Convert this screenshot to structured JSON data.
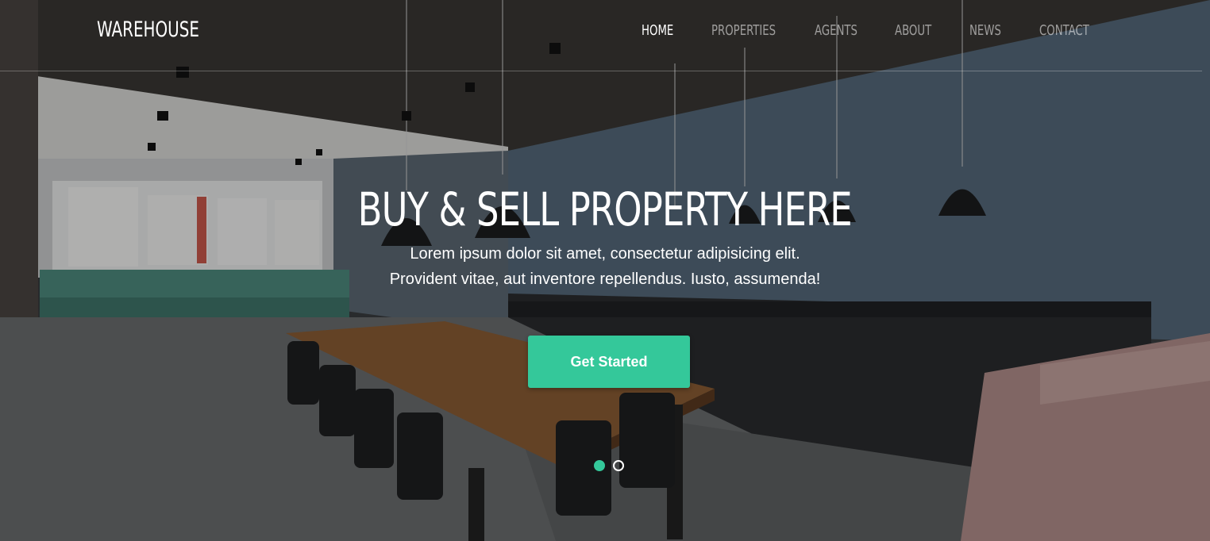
{
  "brand": {
    "name": "WAREHOUSE"
  },
  "nav": {
    "items": [
      {
        "label": "HOME",
        "active": true
      },
      {
        "label": "PROPERTIES",
        "active": false
      },
      {
        "label": "AGENTS",
        "active": false
      },
      {
        "label": "ABOUT",
        "active": false
      },
      {
        "label": "NEWS",
        "active": false
      },
      {
        "label": "CONTACT",
        "active": false
      }
    ]
  },
  "hero": {
    "headline": "BUY & SELL PROPERTY HERE",
    "subtext_line1": "Lorem ipsum dolor sit amet, consectetur adipisicing elit.",
    "subtext_line2": "Provident vitae, aut inventore repellendus. Iusto, assumenda!",
    "cta_label": "Get Started",
    "slide_count": 2,
    "active_slide": 1
  },
  "colors": {
    "accent": "#34c89a",
    "text": "#ffffff",
    "nav_inactive": "rgba(255,255,255,0.55)"
  }
}
